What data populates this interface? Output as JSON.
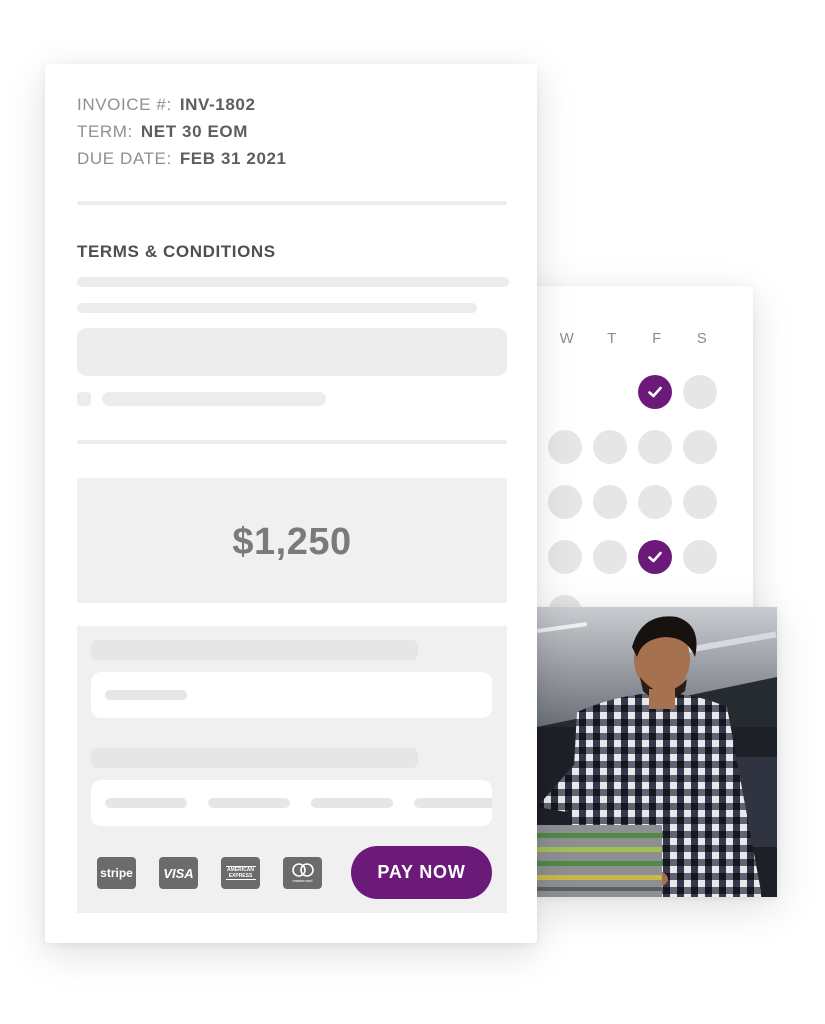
{
  "invoice": {
    "number_label": "INVOICE #:",
    "number_value": "INV-1802",
    "term_label": "TERM:",
    "term_value": "NET 30 EOM",
    "due_label": "DUE DATE:",
    "due_value": "FEB 31 2021",
    "terms_title": "TERMS & CONDITIONS",
    "amount": "$1,250",
    "pay_button": "PAY NOW",
    "payment_methods": [
      {
        "name": "stripe",
        "label": "stripe"
      },
      {
        "name": "visa",
        "label": "VISA"
      },
      {
        "name": "american-express",
        "label": "AMERICAN EXPRESS"
      },
      {
        "name": "mastercard",
        "label": "mastercard"
      }
    ]
  },
  "calendar": {
    "weekdays": [
      "W",
      "T",
      "F",
      "S"
    ]
  },
  "colors": {
    "accent": "#6b1a7a",
    "placeholder": "#ececec",
    "panel": "#f0f0f0"
  },
  "icons": [
    "check-icon",
    "stripe-logo-icon",
    "visa-logo-icon",
    "amex-logo-icon",
    "mastercard-logo-icon"
  ]
}
